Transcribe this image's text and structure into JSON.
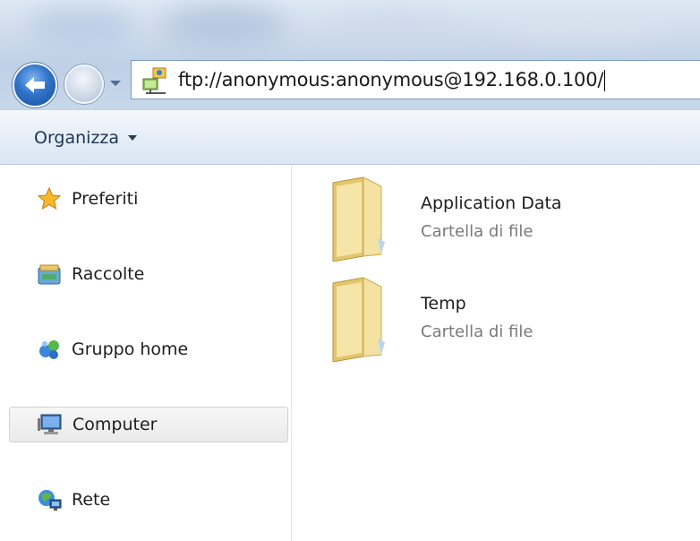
{
  "address_bar": {
    "url": "ftp://anonymous:anonymous@192.168.0.100/",
    "location_icon": "network-location-icon"
  },
  "toolbar": {
    "organize_label": "Organizza"
  },
  "nav_pane": {
    "items": [
      {
        "label": "Preferiti",
        "icon": "star-icon"
      },
      {
        "label": "Raccolte",
        "icon": "libraries-icon"
      },
      {
        "label": "Gruppo home",
        "icon": "homegroup-icon"
      },
      {
        "label": "Computer",
        "icon": "computer-icon",
        "selected": true
      },
      {
        "label": "Rete",
        "icon": "network-icon"
      }
    ]
  },
  "files": [
    {
      "name": "Application Data",
      "type": "Cartella di file",
      "icon": "folder-icon"
    },
    {
      "name": "Temp",
      "type": "Cartella di file",
      "icon": "folder-icon"
    }
  ],
  "colors": {
    "address_border": "#7e9bbd",
    "toolbar_text": "#1e3553",
    "secondary_text": "#7a7a7a"
  }
}
